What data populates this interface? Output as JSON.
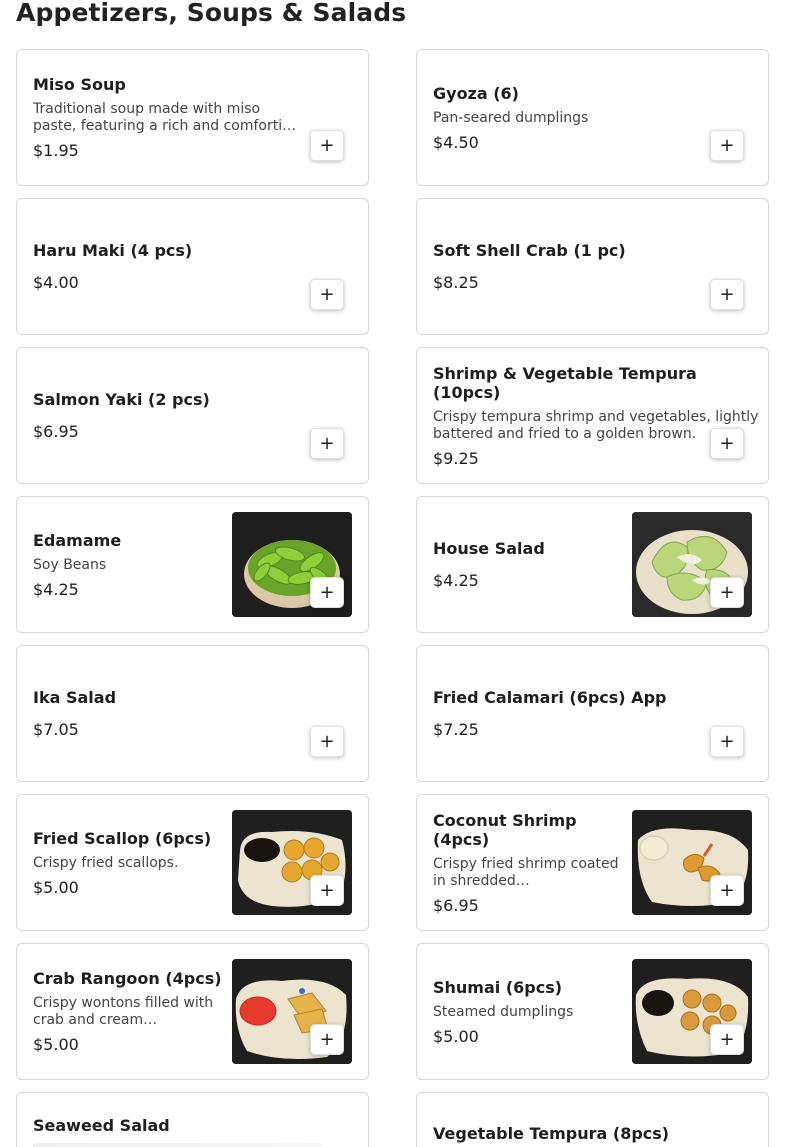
{
  "section": {
    "title": "Appetizers, Soups & Salads"
  },
  "add_label": "+",
  "items": [
    {
      "name": "Miso Soup",
      "desc": "Traditional soup made with miso paste, featuring a rich and comforting broth.",
      "price": "$1.95"
    },
    {
      "name": "Gyoza (6)",
      "desc": "Pan-seared dumplings",
      "price": "$4.50"
    },
    {
      "name": "Haru Maki (4 pcs)",
      "price": "$4.00"
    },
    {
      "name": "Soft Shell Crab (1 pc)",
      "price": "$8.25"
    },
    {
      "name": "Salmon Yaki (2 pcs)",
      "price": "$6.95"
    },
    {
      "name": "Shrimp & Vegetable Tempura (10pcs)",
      "desc": "Crispy tempura shrimp and vegetables, lightly battered and fried to a golden brown.",
      "price": "$9.25"
    },
    {
      "name": "Edamame",
      "desc": "Soy Beans",
      "price": "$4.25",
      "image": "edamame-photo"
    },
    {
      "name": "House Salad",
      "price": "$4.25",
      "image": "house-salad-photo"
    },
    {
      "name": "Ika Salad",
      "price": "$7.05"
    },
    {
      "name": "Fried Calamari (6pcs) App",
      "price": "$7.25"
    },
    {
      "name": "Fried Scallop (6pcs)",
      "desc": "Crispy fried scallops.",
      "price": "$5.00",
      "image": "fried-scallop-photo"
    },
    {
      "name": "Coconut Shrimp (4pcs)",
      "desc": "Crispy fried shrimp coated in shredded…",
      "price": "$6.95",
      "image": "coconut-shrimp-photo"
    },
    {
      "name": "Crab Rangoon (4pcs)",
      "desc": "Crispy wontons filled with crab and cream…",
      "price": "$5.00",
      "image": "crab-rangoon-photo"
    },
    {
      "name": "Shumai (6pcs)",
      "desc": "Steamed dumplings",
      "price": "$5.00",
      "image": "shumai-photo"
    },
    {
      "name": "Seaweed Salad"
    },
    {
      "name": "Vegetable Tempura (8pcs)"
    }
  ]
}
